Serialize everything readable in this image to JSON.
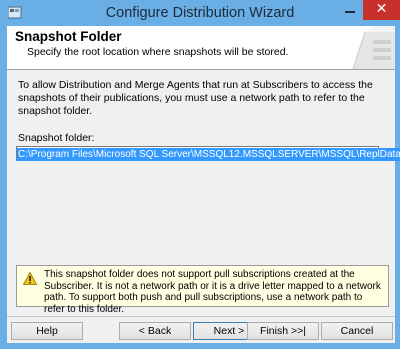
{
  "window": {
    "title": "Configure Distribution Wizard",
    "colors": {
      "frame": "#6aaee6",
      "close": "#c7302b",
      "selection": "#3399ff",
      "warning_bg": "#ffffe1"
    }
  },
  "header": {
    "title": "Snapshot Folder",
    "subtitle": "Specify the root location where snapshots will be stored."
  },
  "body": {
    "intro": "To allow Distribution and Merge Agents that run at Subscribers to access the snapshots of their publications, you must use a network path to refer to the snapshot folder.",
    "folder_label": "Snapshot folder:",
    "folder_value": "C:\\Program Files\\Microsoft SQL Server\\MSSQL12.MSSQLSERVER\\MSSQL\\ReplData"
  },
  "warning": {
    "icon": "warning-triangle-icon",
    "text": "This snapshot folder does not support pull subscriptions created at the Subscriber. It is not a network path or it is a drive letter mapped to a network path. To support both push and pull subscriptions, use a network path to refer to this folder."
  },
  "buttons": {
    "help": "Help",
    "back": "< Back",
    "next": "Next >",
    "finish": "Finish >>|",
    "cancel": "Cancel"
  }
}
